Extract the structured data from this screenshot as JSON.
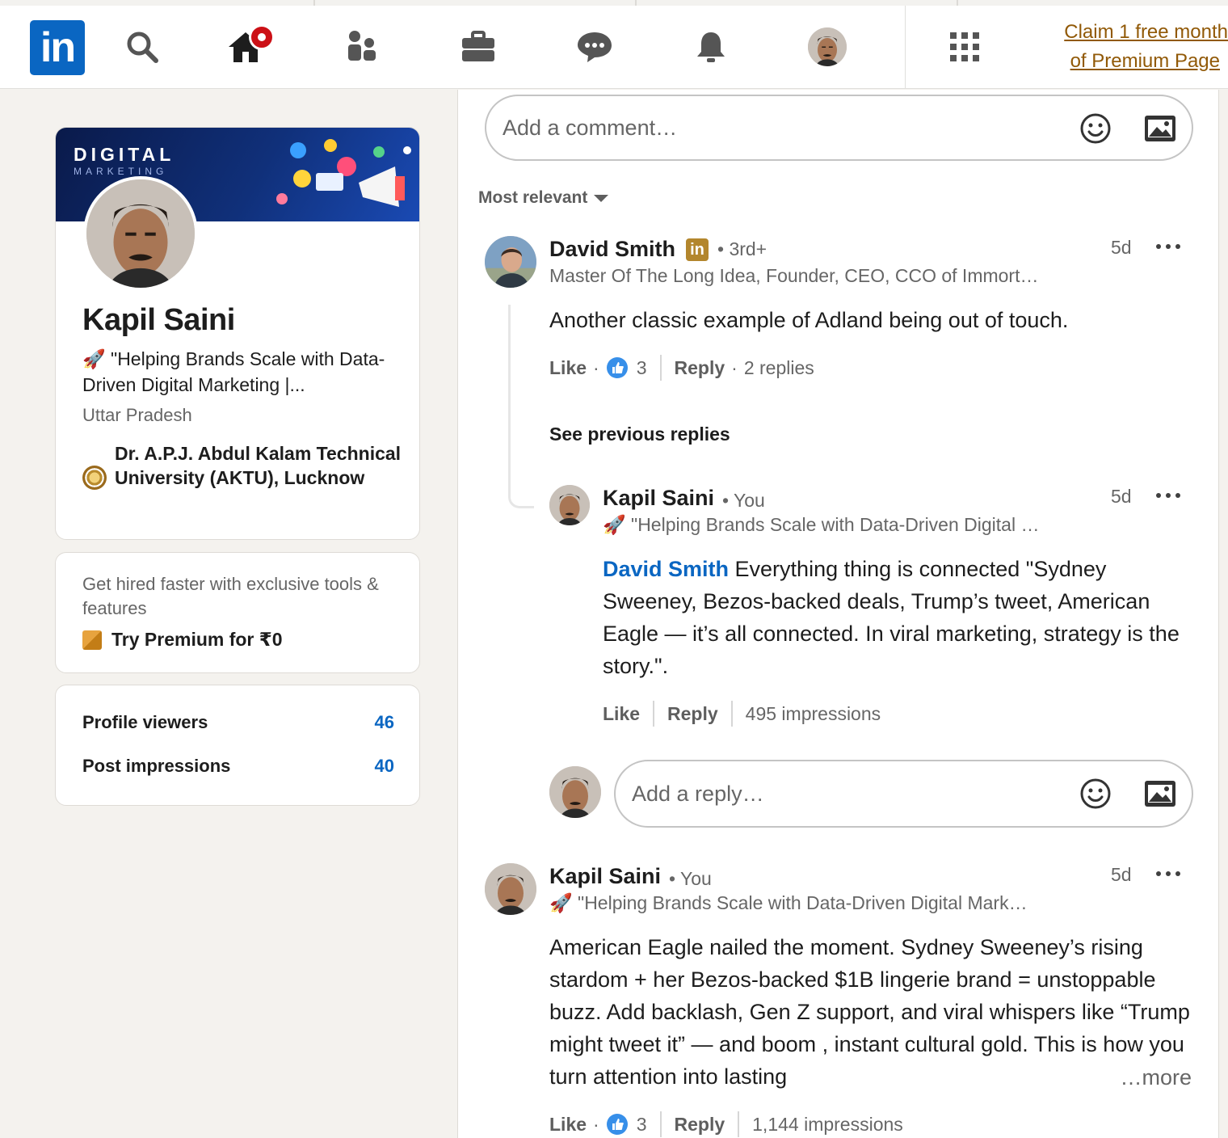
{
  "nav": {
    "logo_text": "in",
    "icons": [
      "search-icon",
      "home-icon",
      "my-network-icon",
      "jobs-icon",
      "messaging-icon",
      "notifications-icon",
      "me-avatar",
      "work-grid-icon"
    ],
    "premium_line1": "Claim 1 free month",
    "premium_line2": "of Premium Page",
    "accent": "#0a66c2",
    "notification_color": "#cc1016"
  },
  "profile": {
    "banner_title": "DIGITAL",
    "banner_subtitle": "MARKETING",
    "name": "Kapil Saini",
    "headline": "🚀 \"Helping Brands Scale with Data-Driven Digital Marketing |...",
    "location": "Uttar Pradesh",
    "education": "Dr. A.P.J. Abdul Kalam Technical University (AKTU), Lucknow"
  },
  "premium": {
    "text": "Get hired faster with exclusive tools & features",
    "cta": "Try Premium for ₹0"
  },
  "stats": [
    {
      "label": "Profile viewers",
      "value": "46"
    },
    {
      "label": "Post impressions",
      "value": "40"
    }
  ],
  "comment_box": {
    "placeholder": "Add a comment…"
  },
  "sort": {
    "label": "Most relevant"
  },
  "comments": [
    {
      "author": "David Smith",
      "degree": "• 3rd+",
      "subtitle": "Master Of The Long Idea, Founder, CEO, CCO of Immort…",
      "time": "5d",
      "text": "Another classic example of Adland being out of touch.",
      "like_label": "Like",
      "like_count": "3",
      "reply_label": "Reply",
      "replies_count": "2 replies"
    },
    {
      "author": "Kapil Saini",
      "degree": "• You",
      "subtitle": "🚀 \"Helping Brands Scale with Data-Driven Digital …",
      "time": "5d",
      "mention": "David Smith",
      "text": " Everything thing is connected \"Sydney Sweeney, Bezos-backed deals, Trump’s tweet, American Eagle — it’s all connected. In viral marketing, strategy is the story.\".",
      "like_label": "Like",
      "reply_label": "Reply",
      "impressions": "495 impressions"
    },
    {
      "author": "Kapil Saini",
      "degree": "• You",
      "subtitle": "🚀 \"Helping Brands Scale with Data-Driven Digital Mark…",
      "time": "5d",
      "text": " American Eagle nailed the moment. Sydney Sweeney’s rising stardom + her Bezos-backed $1B lingerie brand = unstoppable buzz. Add backlash, Gen Z support, and viral whispers like “Trump might tweet it” — and boom , instant cultural gold. This is how you turn attention into lasting",
      "more": "…more",
      "like_label": "Like",
      "like_count": "3",
      "reply_label": "Reply",
      "impressions": "1,144 impressions"
    }
  ],
  "see_previous": "See previous replies",
  "reply_box": {
    "placeholder": "Add a reply…"
  }
}
